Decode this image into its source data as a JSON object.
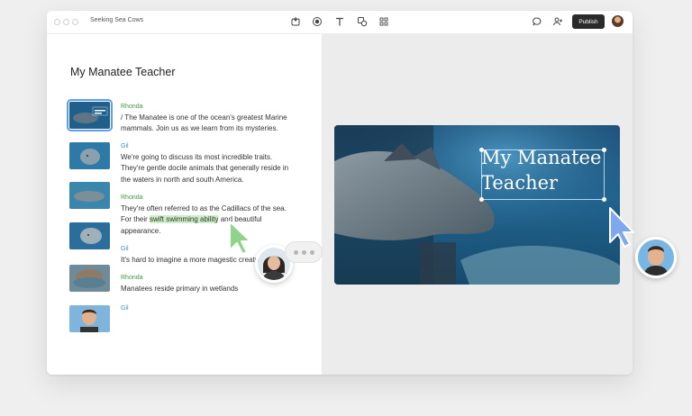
{
  "window": {
    "title": "Seeking Sea Cows"
  },
  "toolbar": {
    "tools": [
      "record-icon",
      "shape-icon",
      "text-icon",
      "layers-icon",
      "grid-icon"
    ],
    "publish_label": "Publish"
  },
  "script": {
    "heading": "My Manatee Teacher",
    "blocks": [
      {
        "speaker": "Rhonda",
        "lines": [
          "/ The Manatee is one of the ocean's greatest Marine",
          "mammals. Join us as we learn from its mysteries."
        ]
      },
      {
        "speaker": "Gil",
        "lines": [
          "We're going to discuss its most incredible traits.",
          "They're gentle docile animals that generally reside in",
          "the waters in north and south America."
        ]
      },
      {
        "speaker": "Rhonda",
        "lines": [
          "They're often referred to as the Cadillacs of the sea.",
          "For their ",
          "swift swimming ability",
          " and beautiful",
          "appearance."
        ]
      },
      {
        "speaker": "Gil",
        "lines": [
          "It's hard to imagine a more magestic creature"
        ]
      },
      {
        "speaker": "Rhonda",
        "lines": [
          "Manatees reside primary in wetlands"
        ]
      },
      {
        "speaker": "Gil",
        "lines": []
      }
    ]
  },
  "preview": {
    "title_line1": "My Manatee",
    "title_line2": "Teacher"
  },
  "colors": {
    "accent_green": "#3f9a3f",
    "accent_blue": "#3e8fd6",
    "highlight": "#cfeec6",
    "publish_bg": "#2b2b2b"
  }
}
